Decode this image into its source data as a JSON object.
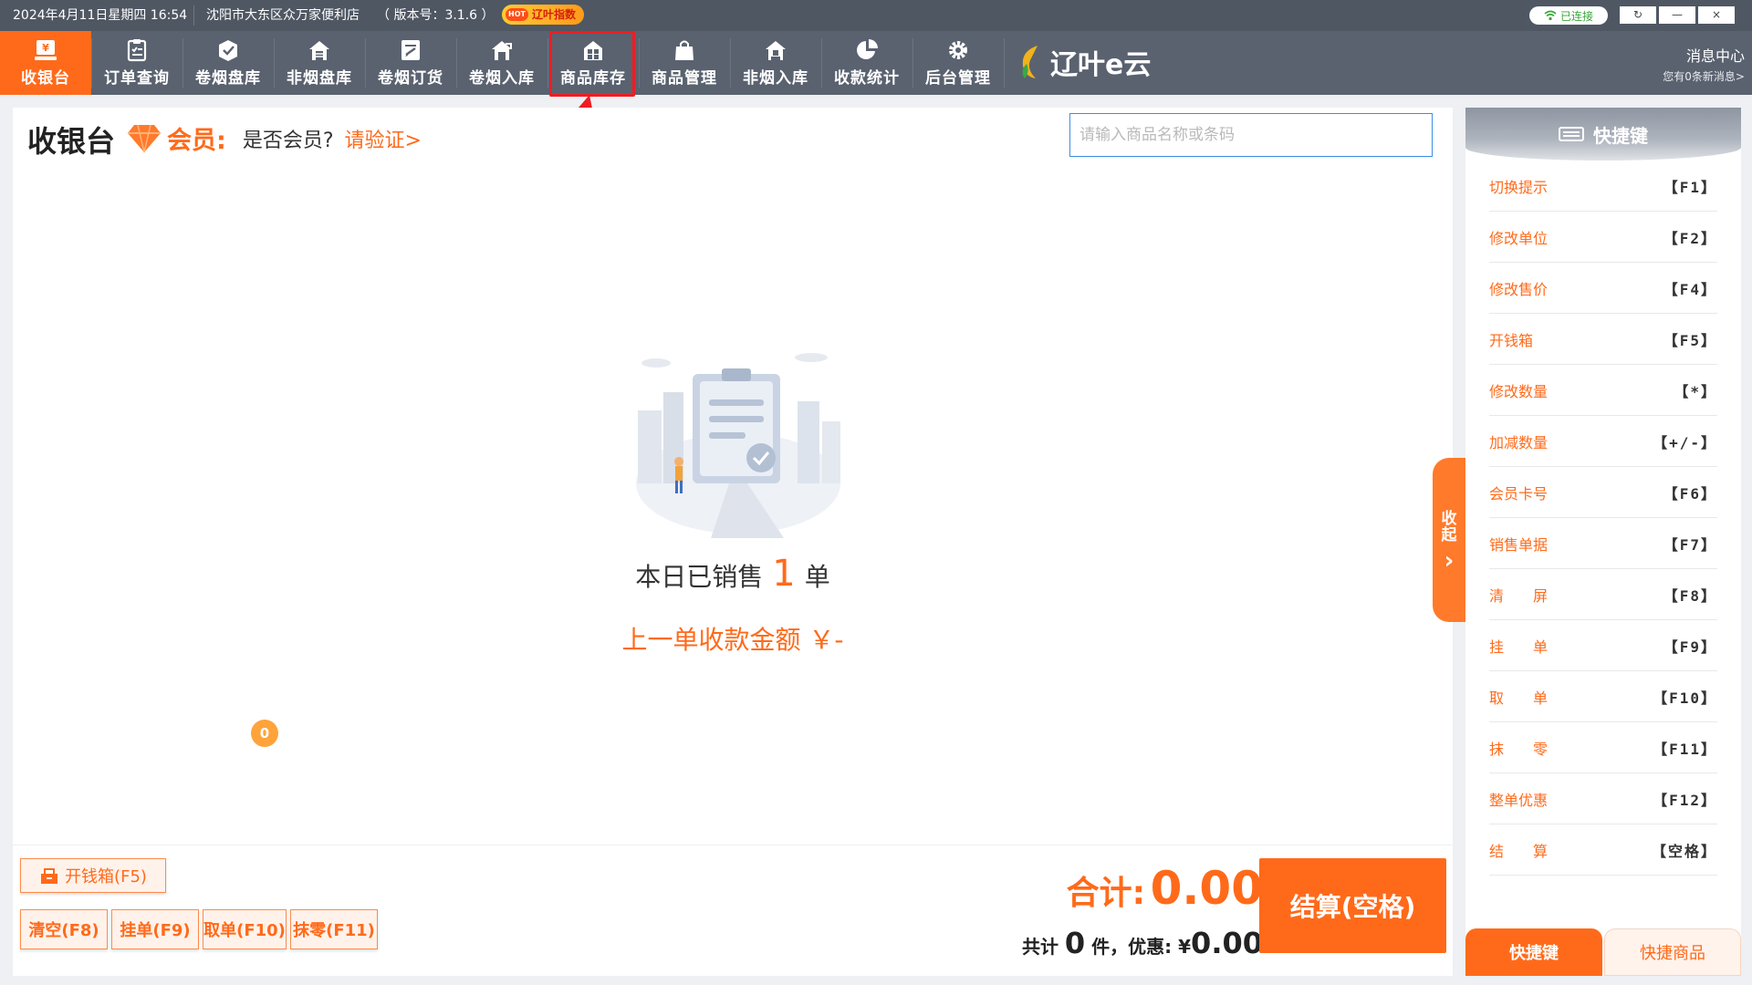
{
  "statusbar": {
    "datetime": "2024年4月11日星期四 16:54",
    "store": "沈阳市大东区众万家便利店",
    "version": "（ 版本号：3.1.6 ）",
    "hot_tag": "HOT",
    "hot_label": "辽叶指数",
    "connection": "已连接",
    "win_refresh": "↻",
    "win_min": "—",
    "win_close": "×"
  },
  "toolbar": {
    "items": [
      {
        "label": "收银台",
        "icon": "cashier-icon"
      },
      {
        "label": "订单查询",
        "icon": "order-search-icon"
      },
      {
        "label": "卷烟盘库",
        "icon": "cigarette-inventory-icon"
      },
      {
        "label": "非烟盘库",
        "icon": "non-cigarette-inventory-icon"
      },
      {
        "label": "卷烟订货",
        "icon": "cigarette-order-icon"
      },
      {
        "label": "卷烟入库",
        "icon": "cigarette-stock-in-icon"
      },
      {
        "label": "商品库存",
        "icon": "goods-stock-icon"
      },
      {
        "label": "商品管理",
        "icon": "goods-manage-icon"
      },
      {
        "label": "非烟入库",
        "icon": "non-cigarette-stock-in-icon"
      },
      {
        "label": "收款统计",
        "icon": "payment-stats-icon"
      },
      {
        "label": "后台管理",
        "icon": "gear-icon"
      }
    ],
    "active_index": 0,
    "highlighted_index": 6,
    "brand": "辽叶e云",
    "message_center": "消息中心",
    "message_summary": "您有0条新消息>"
  },
  "main": {
    "title": "收银台",
    "member_label": "会员:",
    "member_question": "是否会员?",
    "member_verify": "请验证>",
    "search_placeholder": "请输入商品名称或条码",
    "search_value": "",
    "sales_prefix": "本日已销售",
    "sales_count": "1",
    "sales_suffix": "单",
    "last_amount": "上一单收款金额 ￥-",
    "collapse_label_1": "收",
    "collapse_label_2": "起",
    "collapse_arrow": "›"
  },
  "bottom": {
    "cash_drawer": "开钱箱(F5)",
    "clear": "清空(F8)",
    "hold": "挂单(F9)",
    "pick": "取单(F10)",
    "pick_badge": "0",
    "round": "抹零(F11)",
    "total_label": "合计:",
    "total_value": "0.00",
    "summary_prefix": "共计",
    "summary_count": "0",
    "summary_mid": "件，优惠:",
    "summary_currency": "¥",
    "summary_discount": "0.00",
    "checkout": "结算(空格)"
  },
  "sidepanel": {
    "title": "快捷键",
    "shortcuts": [
      {
        "name": "切换提示",
        "key": "【F1】"
      },
      {
        "name": "修改单位",
        "key": "【F2】"
      },
      {
        "name": "修改售价",
        "key": "【F4】"
      },
      {
        "name": "开钱箱",
        "key": "【F5】"
      },
      {
        "name": "修改数量",
        "key": "【*】"
      },
      {
        "name": "加减数量",
        "key": "【+/-】"
      },
      {
        "name": "会员卡号",
        "key": "【F6】"
      },
      {
        "name": "销售单据",
        "key": "【F7】"
      },
      {
        "name": "清　　屏",
        "key": "【F8】"
      },
      {
        "name": "挂　　单",
        "key": "【F9】"
      },
      {
        "name": "取　　单",
        "key": "【F10】"
      },
      {
        "name": "抹　　零",
        "key": "【F11】"
      },
      {
        "name": "整单优惠",
        "key": "【F12】"
      },
      {
        "name": "结　　算",
        "key": "【空格】"
      }
    ],
    "tab_shortcut": "快捷键",
    "tab_goods": "快捷商品"
  },
  "colors": {
    "accent": "#ff6a1a",
    "toolbar_bg": "#5a6270",
    "statusbar_bg": "#4f5763",
    "highlight": "#ee1d23"
  }
}
